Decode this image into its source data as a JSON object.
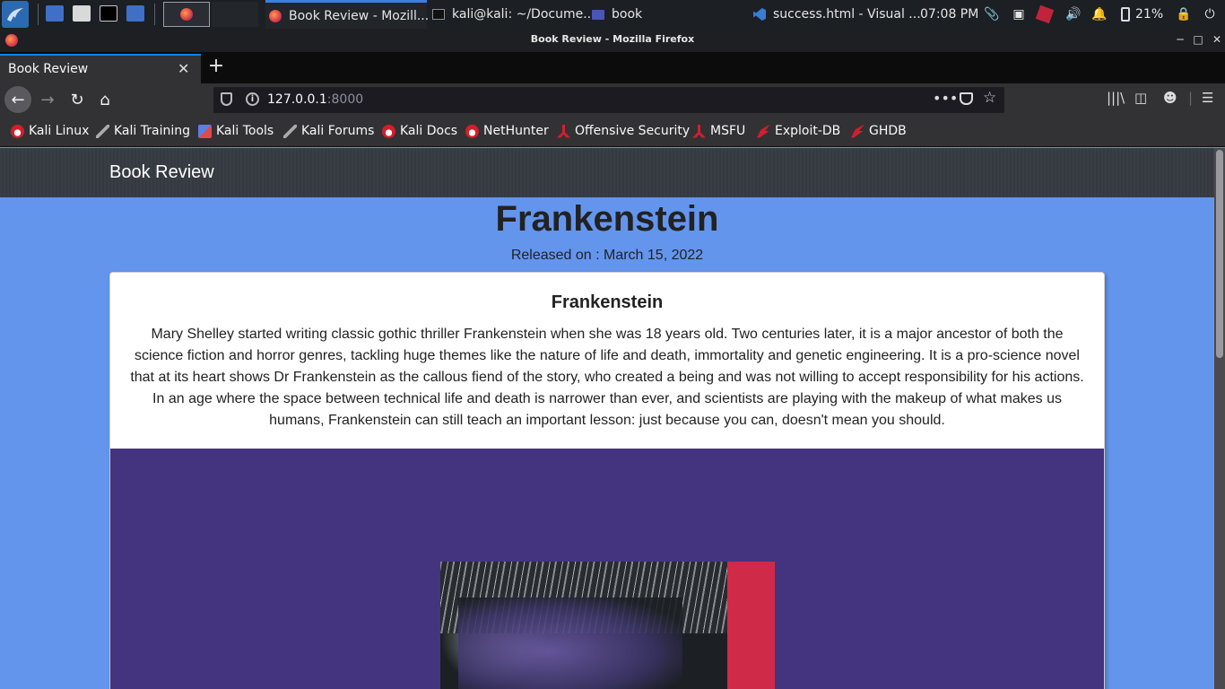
{
  "panel": {
    "tasks": [
      {
        "label": "Book Review - Mozill..."
      },
      {
        "label": "kali@kali: ~/Docume..."
      },
      {
        "label": "book"
      },
      {
        "label": "success.html - Visual ..."
      }
    ],
    "clock": "07:08 PM",
    "battery": "21%"
  },
  "window": {
    "title": "Book Review - Mozilla Firefox"
  },
  "browser": {
    "tab_label": "Book Review",
    "url_host": "127.0.0.1",
    "url_port": ":8000",
    "bookmarks": [
      {
        "label": "Kali Linux"
      },
      {
        "label": "Kali Training"
      },
      {
        "label": "Kali Tools"
      },
      {
        "label": "Kali Forums"
      },
      {
        "label": "Kali Docs"
      },
      {
        "label": "NetHunter"
      },
      {
        "label": "Offensive Security"
      },
      {
        "label": "MSFU"
      },
      {
        "label": "Exploit-DB"
      },
      {
        "label": "GHDB"
      }
    ]
  },
  "page": {
    "brand": "Book Review",
    "book_title": "Frankenstein",
    "release_label": "Released on : ",
    "release_date": "March 15, 2022",
    "card_title": "Frankenstein",
    "description": "Mary Shelley started writing classic gothic thriller Frankenstein when she was 18 years old. Two centuries later, it is a major ancestor of both the science fiction and horror genres, tackling huge themes like the nature of life and death, immortality and genetic engineering. It is a pro-science novel that at its heart shows Dr Frankenstein as the callous fiend of the story, who created a being and was not willing to accept responsibility for his actions. In an age where the space between technical life and death is narrower than ever, and scientists are playing with the makeup of what makes us humans, Frankenstein can still teach an important lesson: just because you can, doesn't mean you should."
  },
  "colors": {
    "page_bg": "#6495ed",
    "navbar_bg": "#343a40",
    "cover_bg": "#44347f"
  }
}
